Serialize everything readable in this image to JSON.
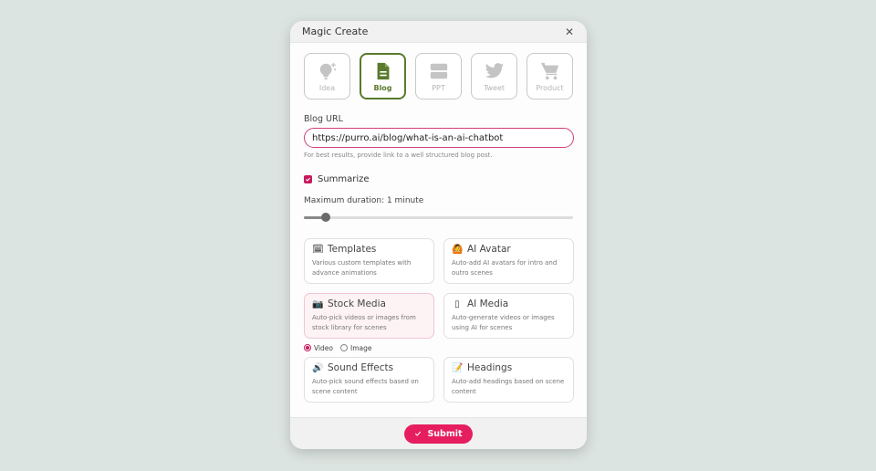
{
  "modal": {
    "title": "Magic Create",
    "close_icon": "close-icon"
  },
  "types": [
    {
      "label": "Idea",
      "icon": "lightbulb-icon",
      "active": false
    },
    {
      "label": "Blog",
      "icon": "document-icon",
      "active": true
    },
    {
      "label": "PPT",
      "icon": "slides-icon",
      "active": false
    },
    {
      "label": "Tweet",
      "icon": "twitter-icon",
      "active": false
    },
    {
      "label": "Product",
      "icon": "cart-icon",
      "active": false
    }
  ],
  "blog_url": {
    "label": "Blog URL",
    "value": "https://purro.ai/blog/what-is-an-ai-chatbot",
    "hint": "For best results, provide link to a well structured blog post."
  },
  "summarize": {
    "label": "Summarize",
    "checked": true
  },
  "duration": {
    "label": "Maximum duration: 1 minute",
    "slider_fraction": 0.08
  },
  "options": [
    {
      "title": "Templates",
      "icon": "🗓",
      "desc": "Various custom templates with advance animations",
      "selected": false
    },
    {
      "title": "AI Avatar",
      "icon": "🙆",
      "desc": "Auto-add AI avatars for intro and outro scenes",
      "selected": false
    },
    {
      "title": "Stock Media",
      "icon": "📷",
      "desc": "Auto-pick videos or images from stock library for scenes",
      "selected": true
    },
    {
      "title": "AI Media",
      "icon": "▯",
      "desc": "Auto-generate videos or images using AI for scenes",
      "selected": false
    },
    {
      "title": "Sound Effects",
      "icon": "🔊",
      "desc": "Auto-pick sound effects based on scene content",
      "selected": false
    },
    {
      "title": "Headings",
      "icon": "📝",
      "desc": "Auto-add headings based on scene content",
      "selected": false
    }
  ],
  "media_type": {
    "options": [
      "Video",
      "Image"
    ],
    "selected": "Video"
  },
  "footer": {
    "submit_label": "Submit"
  },
  "colors": {
    "accent": "#e61e5f",
    "active_type": "#5a7a2c",
    "background": "#dce4e1"
  }
}
